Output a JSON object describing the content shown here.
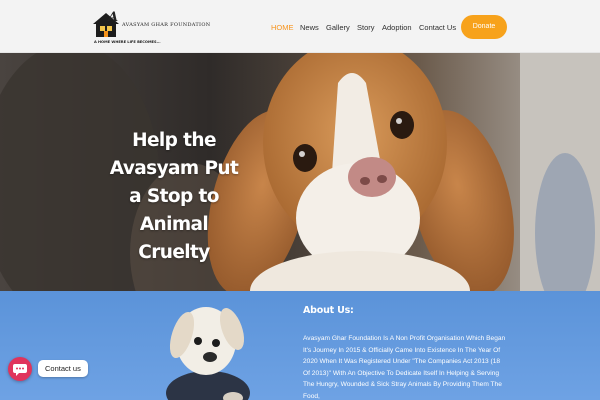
{
  "logo": {
    "letter": "A",
    "name": "AVASYAM GHAR FOUNDATION",
    "tagline": "A HOME WHERE LIFE BECOMES..."
  },
  "nav": {
    "items": [
      {
        "label": "HOME",
        "active": true
      },
      {
        "label": "News"
      },
      {
        "label": "Gallery"
      },
      {
        "label": "Story"
      },
      {
        "label": "Adoption"
      },
      {
        "label": "Contact Us"
      }
    ],
    "donate_label": "Donate"
  },
  "hero": {
    "title": "Help the Avasyam Put a Stop to Animal Cruelty"
  },
  "about": {
    "heading": "About Us:",
    "text": "Avasyam Ghar Foundation Is A Non Profit Organisation Which Began It's Journey In 2015 & Officially Came Into Existence In The Year Of 2020 When It Was Registered Under \"The Companies Act 2013 (18 Of 2013)\" With An Objective To Dedicate Itself In Helping & Serving The Hungry, Wounded & Sick Stray Animals By Providing Them The Food,"
  },
  "contact_widget": {
    "label": "Contact us"
  },
  "colors": {
    "accent": "#f7941d",
    "donate": "#f7a21b",
    "about_bg": "#5b93d9",
    "widget": "#e0345c"
  }
}
